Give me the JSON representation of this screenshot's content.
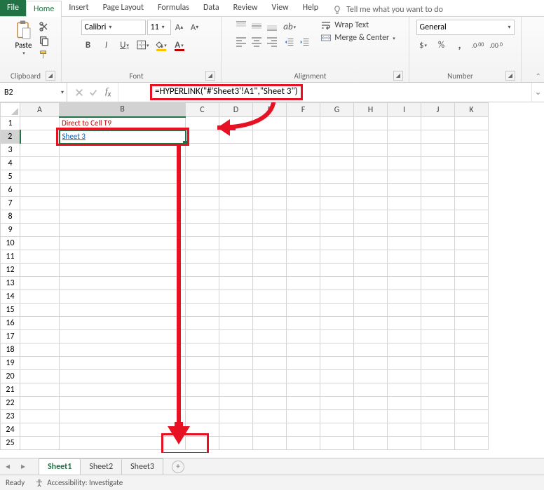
{
  "tabs": {
    "file": "File",
    "home": "Home",
    "insert": "Insert",
    "page_layout": "Page Layout",
    "formulas": "Formulas",
    "data": "Data",
    "review": "Review",
    "view": "View",
    "help": "Help",
    "tellme": "Tell me what you want to do"
  },
  "ribbon": {
    "clipboard": {
      "paste": "Paste",
      "label": "Clipboard"
    },
    "font": {
      "name": "Calibri",
      "size": "11",
      "label": "Font"
    },
    "alignment": {
      "wrap": "Wrap Text",
      "merge": "Merge & Center",
      "label": "Alignment"
    },
    "number": {
      "format": "General",
      "label": "Number"
    }
  },
  "namebox": "B2",
  "formula": "=HYPERLINK(\"#'Sheet3'!A1\",\"Sheet 3\")",
  "grid": {
    "columns": [
      "A",
      "B",
      "C",
      "D",
      "E",
      "F",
      "G",
      "H",
      "I",
      "J",
      "K"
    ],
    "rows": 25,
    "b1": "Direct to Cell T9",
    "b2": "Sheet 3"
  },
  "sheets": [
    "Sheet1",
    "Sheet2",
    "Sheet3"
  ],
  "active_sheet": "Sheet1",
  "status": {
    "ready": "Ready",
    "accessibility": "Accessibility: Investigate"
  }
}
